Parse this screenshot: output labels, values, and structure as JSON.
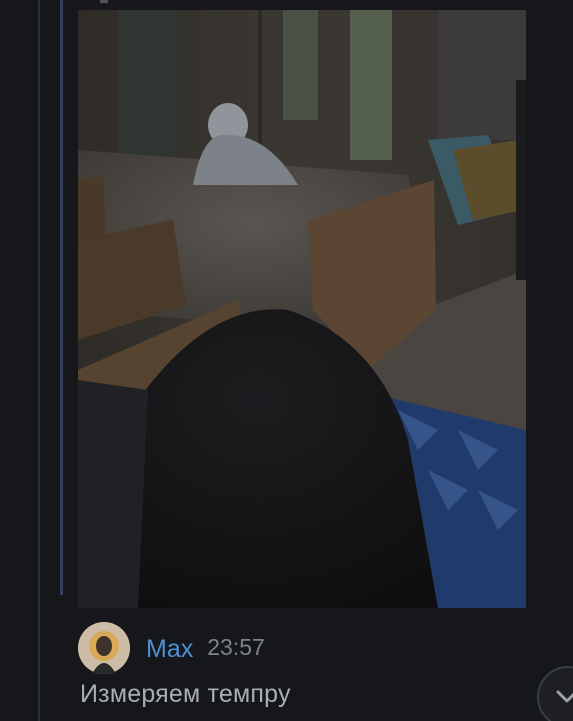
{
  "message": {
    "sender": "Max",
    "time": "23:57",
    "text": "Измеряем темпру"
  },
  "photo": {
    "description_icon": "photo-attachment"
  },
  "icons": {
    "avatar": "avatar-icon",
    "scroll_down": "chevron-down-icon"
  },
  "colors": {
    "background": "#16171b",
    "sender_name": "#4f8fd6",
    "timestamp": "#7d828c",
    "message_text": "#a9adb5",
    "thread_line": "#2b3140"
  }
}
